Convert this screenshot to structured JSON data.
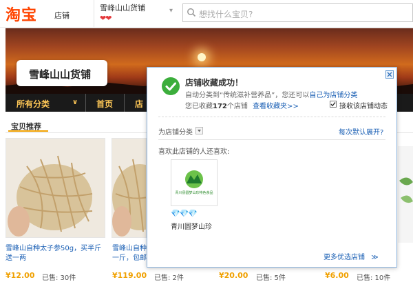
{
  "header": {
    "logo": "淘宝",
    "logo_sub": "店铺",
    "shop_name": "雪峰山山货铺",
    "hearts": "❤❤",
    "search_placeholder": "想找什么宝贝?"
  },
  "banner": {
    "shop_card": "雪峰山山货铺"
  },
  "nav": {
    "items": [
      {
        "label": "所有分类"
      },
      {
        "label": "首页"
      },
      {
        "label": "店"
      }
    ]
  },
  "section": {
    "title": "宝贝推荐"
  },
  "products": [
    {
      "title_line1": "雪峰山自种太子参50g，买半斤",
      "title_line2": "送一两",
      "price": "¥12.00",
      "sold": "已售: 30件"
    },
    {
      "title_line1": "雪峰山自种",
      "title_line2": "一斤，包邮",
      "price": "¥119.00",
      "sold": "已售: 2件"
    },
    {
      "title_line1": "",
      "title_line2": "",
      "price": "¥20.00",
      "sold": "已售: 5件"
    },
    {
      "title_line1": "",
      "title_line2": "",
      "price": "¥6.00",
      "sold": "已售: 10件"
    }
  ],
  "popup": {
    "title": "店铺收藏成功！",
    "line1_prefix": "自动分类到",
    "line1_category": "“传统滋补营养品”",
    "line1_mid": "，您还可以",
    "line1_link": "自己为店铺分类",
    "line2_prefix": "您已收藏",
    "line2_count": "172",
    "line2_suffix": "个店铺",
    "view_fav_link": "查看收藏夹>>",
    "receive_checkbox_label": "接收该店铺动态",
    "classify_label": "为店铺分类",
    "default_expand": "每次默认展开?",
    "also_like": "喜欢此店铺的人还喜欢:",
    "rec_shop_name": "青川圆梦山珍",
    "rec_logo_text": "青川县圆梦山珍特色食品",
    "more_shops_link": "更多优选店铺",
    "colors": {
      "success": "#3cae3c",
      "link": "#1a5fb4",
      "price": "#f0a000",
      "brand": "#ff4400"
    }
  }
}
